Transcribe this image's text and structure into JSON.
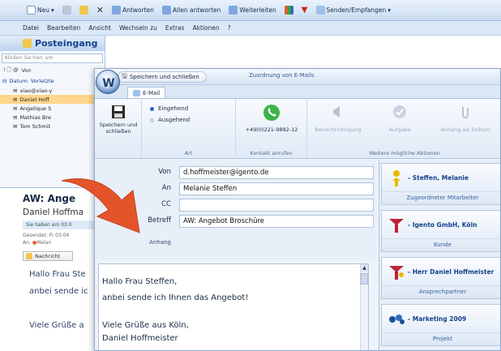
{
  "outlook": {
    "toolbar": [
      "Neu",
      "Antworten",
      "Allen antworten",
      "Weiterleiten",
      "Senden/Empfangen"
    ],
    "menu": [
      "Datei",
      "Bearbeiten",
      "Ansicht",
      "Wechseln zu",
      "Extras",
      "Aktionen",
      "?"
    ],
    "folder": {
      "title": "Posteingang",
      "search_placeholder": "Klicken Sie hier, um",
      "col_header": "Von",
      "group": "Datum: Vorletzte",
      "rows": [
        "xiao@xiao-y",
        "Daniel Hoff",
        "Angelique S",
        "Mathias Bre",
        "Tom Schmit"
      ]
    },
    "preview": {
      "subject": "AW: Ange",
      "sender": "Daniel Hoffma",
      "infobar": "Sie haben am 03.0",
      "sent_label": "Gesendet:",
      "sent_value": "Fr 03.04",
      "to_label": "An:",
      "to_value": "Melan",
      "button": "Nachricht",
      "body": [
        "Hallo Frau Ste",
        "anbei sende ic",
        "",
        "Viele Grüße a"
      ]
    }
  },
  "dialog": {
    "save_close": "Speichern und schließen",
    "caption": "Zuordnung von E-Mails",
    "tab": "E-Mail",
    "ribbon": {
      "save_big": "Speichern und schließen",
      "radio_in": "Eingehend",
      "radio_out": "Ausgehend",
      "group_art": "Art",
      "phone": "+49(0)221-9882-12",
      "group_contact": "Kontakt anrufen",
      "notify": "Benachrichtigung",
      "task": "Aufgabe",
      "attach": "Anhang als Dokum",
      "group_more": "Weitere mögliche Aktionen"
    },
    "fields": {
      "from_label": "Von",
      "from_value": "d.hoffmeister@igento.de",
      "to_label": "An",
      "to_value": "Melanie Steffen",
      "cc_label": "CC",
      "cc_value": "",
      "subject_label": "Betreff",
      "subject_value": "AW: Angebot Broschüre",
      "attachment_label": "Anhang"
    },
    "body": [
      "Hallo Frau Steffen,",
      "anbei sende ich Ihnen das Angebot!",
      "",
      "Viele Grüße aus Köln,",
      "Daniel Hoffmeister"
    ],
    "cards": [
      {
        "title": "Steffen, Melanie",
        "sub": "Zugeordneter Mitarbeiter",
        "icon": "person-icon",
        "color": "#e8b800"
      },
      {
        "title": "Igento GmbH, Köln",
        "sub": "Kunde",
        "icon": "company-icon",
        "color": "#c0203a"
      },
      {
        "title": "Herr Daniel Hoffmeister",
        "sub": "Ansprechpartner",
        "icon": "contact-icon",
        "color": "#c0203a"
      },
      {
        "title": "Marketing 2009",
        "sub": "Projekt",
        "icon": "project-icon",
        "color": "#1c4f9c"
      }
    ]
  },
  "colors": {
    "accent": "#15428b",
    "arrow": "#e4542a",
    "selected_row": "#ffd68a"
  }
}
